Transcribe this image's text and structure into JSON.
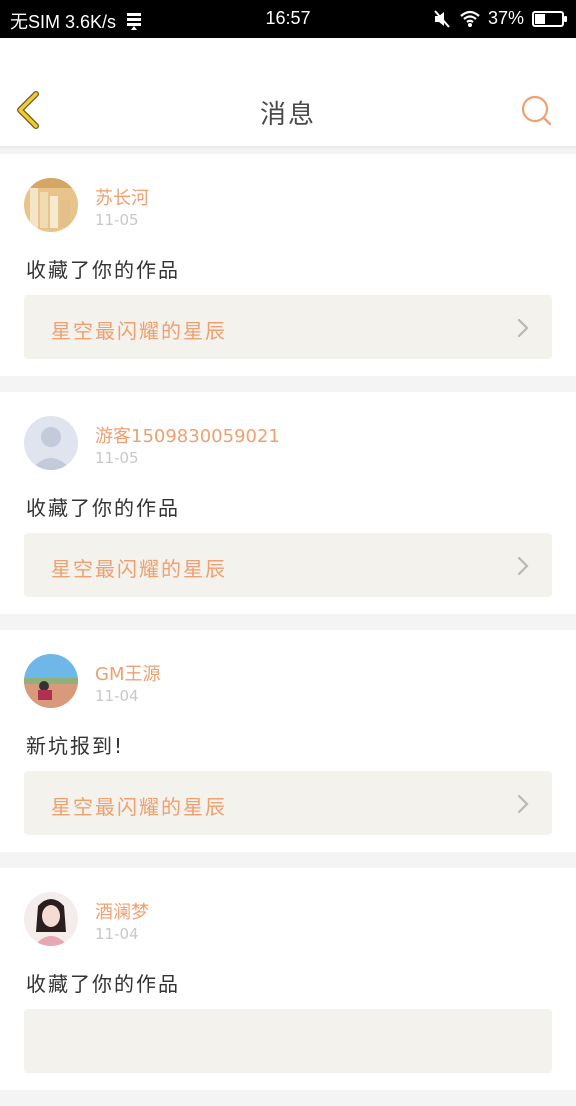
{
  "statusbar": {
    "carrier": "无SIM 3.6K/s",
    "time": "16:57",
    "battery": "37%",
    "battery_level": 0.37
  },
  "header": {
    "title": "消息",
    "back_icon": "chevron-left-icon",
    "search_icon": "search-icon"
  },
  "colors": {
    "accent": "#f0a070",
    "back_arrow": "#f2cc30",
    "card_link_bg": "#f3f2ec"
  },
  "messages": [
    {
      "username": "苏长河",
      "date": "11-05",
      "action": "收藏了你的作品",
      "work_title": "星空最闪耀的星辰"
    },
    {
      "username": "游客1509830059021",
      "date": "11-05",
      "action": "收藏了你的作品",
      "work_title": "星空最闪耀的星辰"
    },
    {
      "username": "GM王源",
      "date": "11-04",
      "action": "新坑报到!",
      "work_title": "星空最闪耀的星辰"
    },
    {
      "username": "酒澜梦",
      "date": "11-04",
      "action": "收藏了你的作品",
      "work_title": ""
    }
  ]
}
